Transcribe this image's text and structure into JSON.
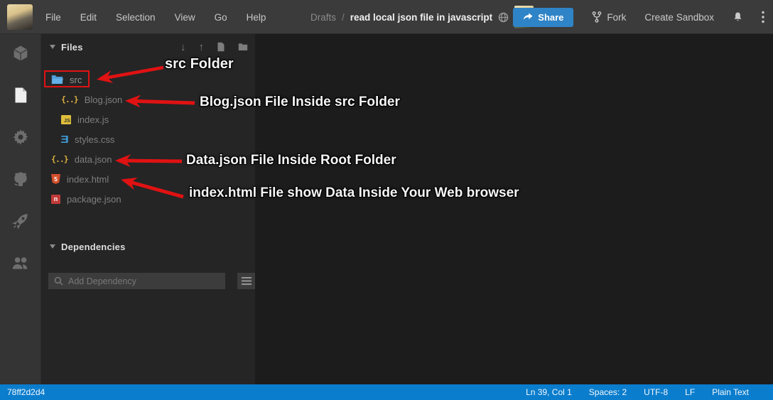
{
  "topbar": {
    "menus": [
      "File",
      "Edit",
      "Selection",
      "View",
      "Go",
      "Help"
    ],
    "breadcrumb": {
      "parent": "Drafts",
      "separator": "/",
      "title": "read local json file in javascript"
    },
    "share_label": "Share",
    "fork_label": "Fork",
    "create_sandbox_label": "Create Sandbox"
  },
  "activity_bar": {
    "items": [
      "sandbox-cube",
      "files-explorer",
      "configuration-gear",
      "github",
      "deployment-rocket",
      "live-collaboration-users"
    ]
  },
  "explorer": {
    "files_header": {
      "label": "Files"
    },
    "tree": [
      {
        "name": "src",
        "type": "folder-open",
        "indent": 0,
        "highlighted": true
      },
      {
        "name": "Blog.json",
        "type": "json",
        "indent": 1
      },
      {
        "name": "index.js",
        "type": "javascript",
        "indent": 1
      },
      {
        "name": "styles.css",
        "type": "css",
        "indent": 1
      },
      {
        "name": "data.json",
        "type": "json",
        "indent": 0
      },
      {
        "name": "index.html",
        "type": "html",
        "indent": 0
      },
      {
        "name": "package.json",
        "type": "npm",
        "indent": 0
      }
    ],
    "dependencies_header": {
      "label": "Dependencies"
    },
    "add_dependency": {
      "placeholder": "Add Dependency",
      "value": ""
    }
  },
  "annotations": [
    {
      "text": "src Folder"
    },
    {
      "text": "Blog.json File Inside src Folder"
    },
    {
      "text": "Data.json File Inside Root Folder"
    },
    {
      "text": "index.html File show Data Inside Your Web browser"
    }
  ],
  "statusbar": {
    "left": "78ff2d2d4",
    "right": [
      "Ln 39, Col 1",
      "Spaces: 2",
      "UTF-8",
      "LF",
      "Plain Text"
    ]
  },
  "colors": {
    "share_blue": "#2f84c7",
    "statusbar_blue": "#0b7dcd",
    "annotation_red": "#e01212",
    "folder_blue": "#4f9cd8",
    "json_yellow": "#d9ae3e",
    "js_yellow": "#dfbe3d",
    "css_blue": "#3f9bd8",
    "html_orange": "#d4502b",
    "npm_red": "#c23b38"
  }
}
